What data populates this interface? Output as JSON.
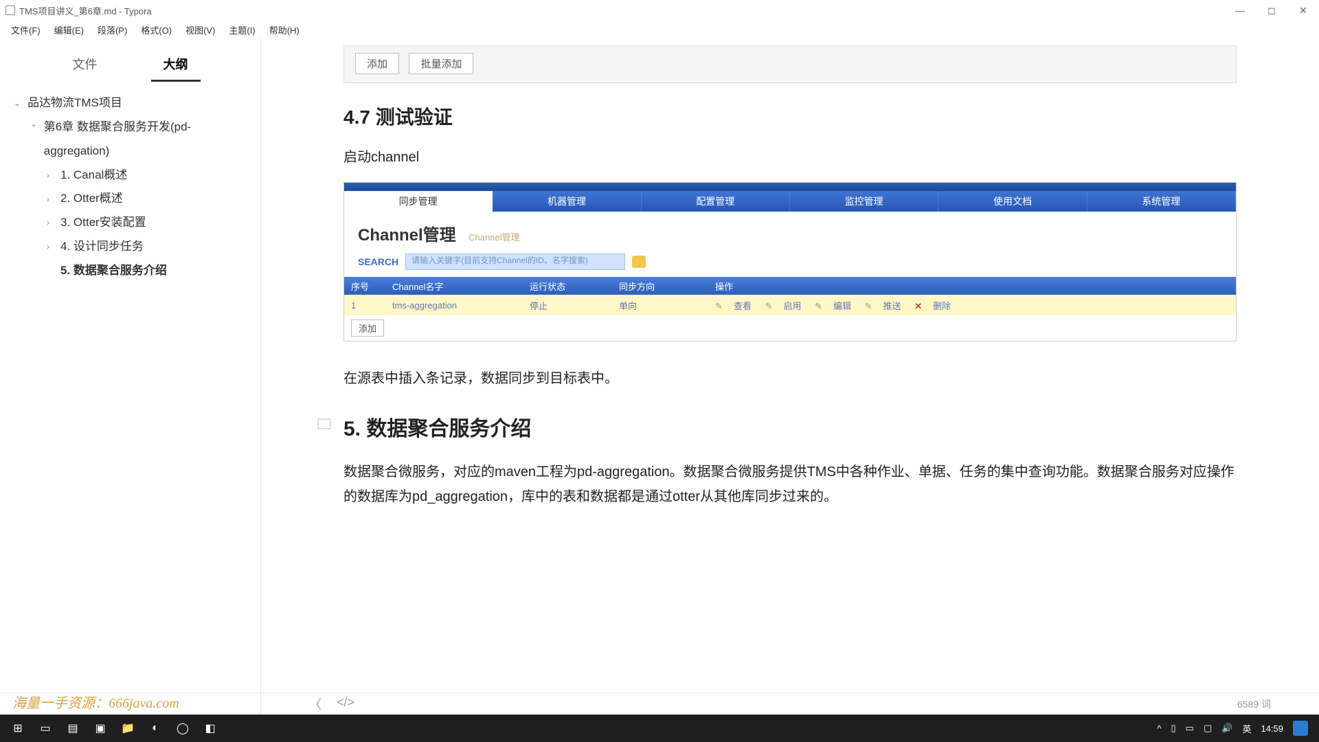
{
  "window": {
    "title": "TMS项目讲义_第6章.md - Typora"
  },
  "menu": {
    "file": "文件(F)",
    "edit": "编辑(E)",
    "para": "段落(P)",
    "format": "格式(O)",
    "view": "视图(V)",
    "theme": "主题(I)",
    "help": "帮助(H)"
  },
  "sidebar": {
    "tabs": {
      "files": "文件",
      "outline": "大纲"
    },
    "root": "品达物流TMS项目",
    "chapter": "第6章 数据聚合服务开发(pd-aggregation)",
    "items": [
      "1. Canal概述",
      "2. Otter概述",
      "3. Otter安装配置",
      "4. 设计同步任务",
      "5. 数据聚合服务介绍"
    ]
  },
  "content": {
    "btn_add": "添加",
    "btn_batch": "批量添加",
    "h47": "4.7 测试验证",
    "p_start": "启动channel",
    "p_insert": "在源表中插入条记录，数据同步到目标表中。",
    "h5": "5. 数据聚合服务介绍",
    "p_body": "数据聚合微服务，对应的maven工程为pd-aggregation。数据聚合微服务提供TMS中各种作业、单据、任务的集中查询功能。数据聚合服务对应操作的数据库为pd_aggregation，库中的表和数据都是通过otter从其他库同步过来的。"
  },
  "otter": {
    "tabs": [
      "同步管理",
      "机器管理",
      "配置管理",
      "监控管理",
      "使用文档",
      "系统管理"
    ],
    "title": "Channel管理",
    "breadcrumb": "Channel管理",
    "search_label": "SEARCH",
    "search_placeholder": "请输入关键字(目前支持Channel的ID、名字搜索)",
    "cols": [
      "序号",
      "Channel名字",
      "运行状态",
      "同步方向",
      "操作"
    ],
    "row": {
      "id": "1",
      "name": "tms-aggregation",
      "status": "停止",
      "dir": "单向"
    },
    "ops": {
      "view": "查看",
      "start": "启用",
      "edit": "编辑",
      "push": "推送",
      "del": "删除"
    },
    "foot_add": "添加"
  },
  "status": {
    "wordcount": "6589 词"
  },
  "watermark": "海量一手资源：666java.com",
  "tray": {
    "time": "14:59",
    "ime": "英"
  }
}
